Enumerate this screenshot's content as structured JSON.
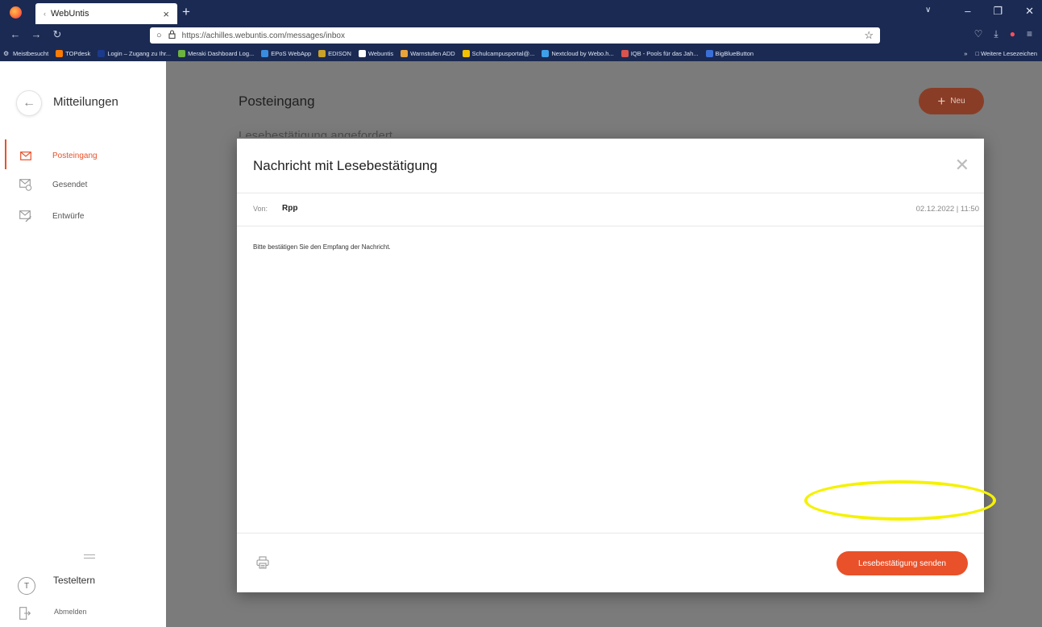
{
  "browser": {
    "tab_title": "WebUntis",
    "tab_favicon": "‹",
    "tab_close": "×",
    "new_tab": "+",
    "url": "https://achilles.webuntis.com/messages/inbox",
    "bookmarks": [
      {
        "label": "Meistbesucht",
        "color": "#dfe6f5"
      },
      {
        "label": "TOPdesk",
        "color": "#ff7a00"
      },
      {
        "label": "Login – Zugang zu Ihr...",
        "color": "#1b3a8c"
      },
      {
        "label": "Meraki Dashboard Log...",
        "color": "#6cb33f"
      },
      {
        "label": "EPoS WebApp",
        "color": "#3a8dde"
      },
      {
        "label": "EDISON",
        "color": "#c9a227"
      },
      {
        "label": "Webuntis",
        "color": "#ffffff"
      },
      {
        "label": "Warnstufen ADD",
        "color": "#e8a33d"
      },
      {
        "label": "Schulcampusportal@...",
        "color": "#f2c200"
      },
      {
        "label": "Nextcloud by Webo.h...",
        "color": "#3da0e8"
      },
      {
        "label": "IQB - Pools für das Jah...",
        "color": "#d9534f"
      },
      {
        "label": "BigBlueButton",
        "color": "#3a6fd8"
      }
    ],
    "more_bookmarks": "Weitere Lesezeichen"
  },
  "sidebar": {
    "title": "Mitteilungen",
    "items": [
      {
        "label": "Posteingang",
        "active": true
      },
      {
        "label": "Gesendet",
        "active": false
      },
      {
        "label": "Entwürfe",
        "active": false
      }
    ],
    "user_initial": "T",
    "user_name": "Testeltern",
    "logout": "Abmelden"
  },
  "main": {
    "title": "Posteingang",
    "new_button": "Neu",
    "list_hint": "Lesebestätigung angefordert"
  },
  "modal": {
    "title": "Nachricht mit Lesebestätigung",
    "from_label": "Von:",
    "from_name": "Rpp",
    "date": "02.12.2022 | 11:50",
    "body": "Bitte bestätigen Sie den Empfang der Nachricht.",
    "send_button": "Lesebestätigung senden"
  },
  "colors": {
    "accent": "#e8512a",
    "browser_bg": "#1b2a52",
    "highlight": "#f5f200"
  }
}
